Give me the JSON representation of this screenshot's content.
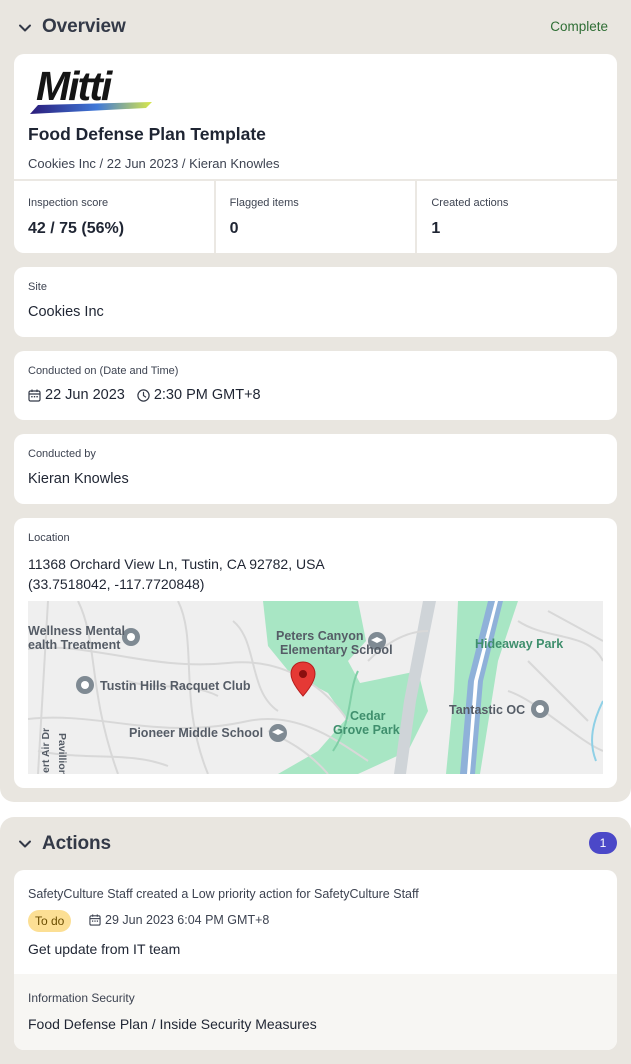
{
  "overview": {
    "title": "Overview",
    "status": "Complete",
    "logo_text": "Mitti",
    "template_title": "Food Defense Plan Template",
    "subtitle": "Cookies Inc / 22 Jun 2023 / Kieran Knowles",
    "stats": [
      {
        "label": "Inspection score",
        "value": "42 / 75 (56%)"
      },
      {
        "label": "Flagged items",
        "value": "0"
      },
      {
        "label": "Created actions",
        "value": "1"
      }
    ],
    "site": {
      "label": "Site",
      "value": "Cookies Inc"
    },
    "conducted_on": {
      "label": "Conducted on (Date and Time)",
      "date": "22 Jun 2023",
      "time": "2:30 PM GMT+8"
    },
    "conducted_by": {
      "label": "Conducted by",
      "value": "Kieran Knowles"
    },
    "location": {
      "label": "Location",
      "address": "11368 Orchard View Ln, Tustin, CA 92782, USA",
      "coords": "(33.7518042, -117.7720848)",
      "map_labels": {
        "wellness_1": "Wellness Mental",
        "wellness_2": "ealth Treatment",
        "school_1": "Peters Canyon",
        "school_2": "Elementary School",
        "hideaway": "Hideaway Park",
        "racquet": "Tustin Hills Racquet Club",
        "tantastic": "Tantastic OC",
        "cedar_1": "Cedar",
        "cedar_2": "Grove Park",
        "pioneer": "Pioneer Middle School",
        "pavillion": "Pavillion D",
        "airdr": "ert Air Dr"
      }
    }
  },
  "actions": {
    "title": "Actions",
    "count": "1",
    "items": [
      {
        "description": "SafetyCulture Staff created a Low priority action for SafetyCulture Staff",
        "status": "To do",
        "date": "29 Jun 2023 6:04 PM GMT+8",
        "title": "Get update from IT team",
        "category": "Information Security",
        "path": "Food Defense Plan / Inside Security Measures"
      }
    ]
  },
  "colors": {
    "section_bg": "#e9e6e0",
    "complete_green": "#2f6e35",
    "badge_purple": "#4b48c8",
    "todo_yellow": "#fcdf94",
    "map_pin": "#e53935"
  }
}
